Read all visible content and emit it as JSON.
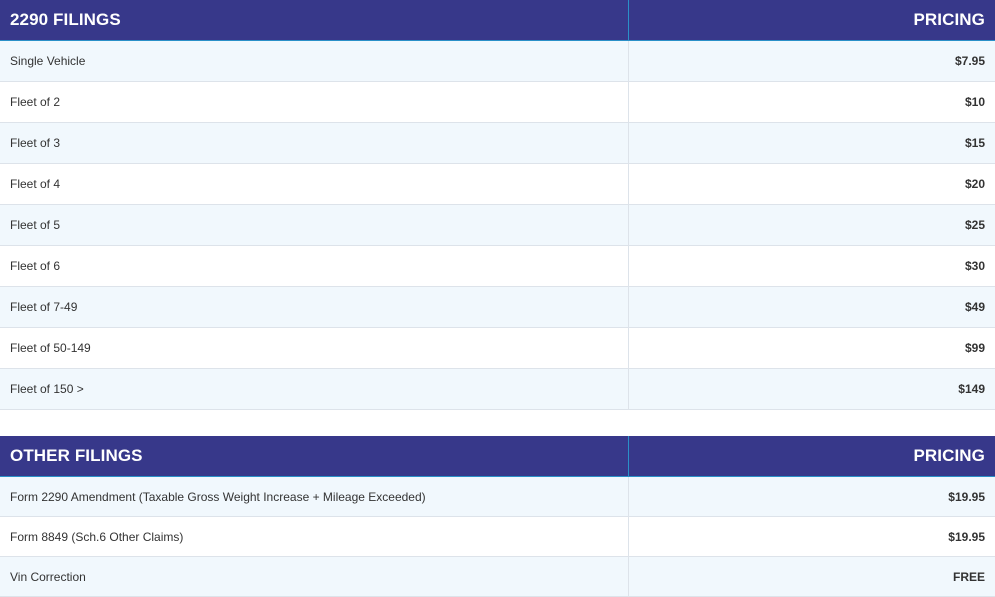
{
  "filings_2290": {
    "heading": "2290 FILINGS",
    "pricing_heading": "PRICING",
    "rows": [
      {
        "name": "Single Vehicle",
        "price": "$7.95"
      },
      {
        "name": "Fleet of 2",
        "price": "$10"
      },
      {
        "name": "Fleet of 3",
        "price": "$15"
      },
      {
        "name": "Fleet of 4",
        "price": "$20"
      },
      {
        "name": "Fleet of 5",
        "price": "$25"
      },
      {
        "name": "Fleet of 6",
        "price": "$30"
      },
      {
        "name": "Fleet of 7-49",
        "price": "$49"
      },
      {
        "name": "Fleet of 50-149",
        "price": "$99"
      },
      {
        "name": "Fleet of 150 >",
        "price": "$149"
      }
    ]
  },
  "other_filings": {
    "heading": "OTHER FILINGS",
    "pricing_heading": "PRICING",
    "rows": [
      {
        "name": "Form 2290 Amendment (Taxable Gross Weight Increase + Mileage Exceeded)",
        "price": "$19.95"
      },
      {
        "name": "Form 8849 (Sch.6 Other Claims)",
        "price": "$19.95"
      },
      {
        "name": "Vin Correction",
        "price": "FREE"
      }
    ]
  },
  "colors": {
    "header_bg": "#37388a",
    "header_text": "#ffffff",
    "row_alt_bg": "#f1f8fd"
  }
}
